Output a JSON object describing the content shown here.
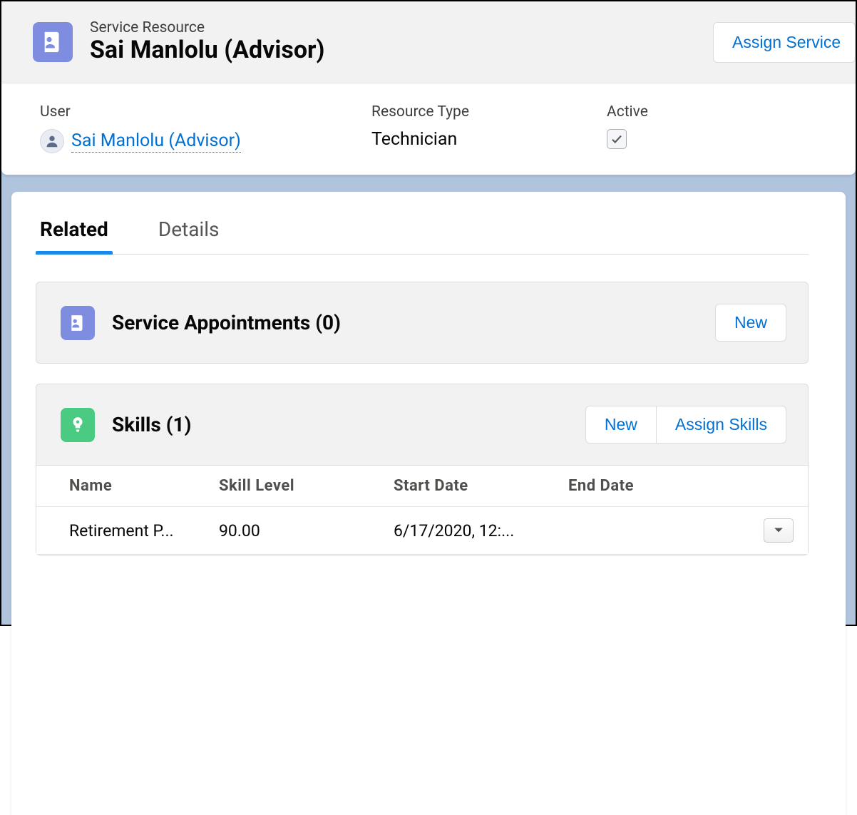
{
  "header": {
    "eyebrow": "Service Resource",
    "title": "Sai Manlolu (Advisor)",
    "assign_button_label": "Assign Service"
  },
  "fields": {
    "user_label": "User",
    "user_value": "Sai Manlolu (Advisor)",
    "type_label": "Resource Type",
    "type_value": "Technician",
    "active_label": "Active",
    "active_checked": true
  },
  "tabs": {
    "related": "Related",
    "details": "Details"
  },
  "service_appointments": {
    "title": "Service Appointments (0)",
    "new_button": "New"
  },
  "skills": {
    "title": "Skills (1)",
    "new_button": "New",
    "assign_button": "Assign Skills",
    "columns": {
      "name": "Name",
      "level": "Skill Level",
      "start": "Start Date",
      "end": "End Date"
    },
    "rows": [
      {
        "name": "Retirement P...",
        "level": "90.00",
        "start": "6/17/2020, 12:...",
        "end": ""
      }
    ]
  }
}
